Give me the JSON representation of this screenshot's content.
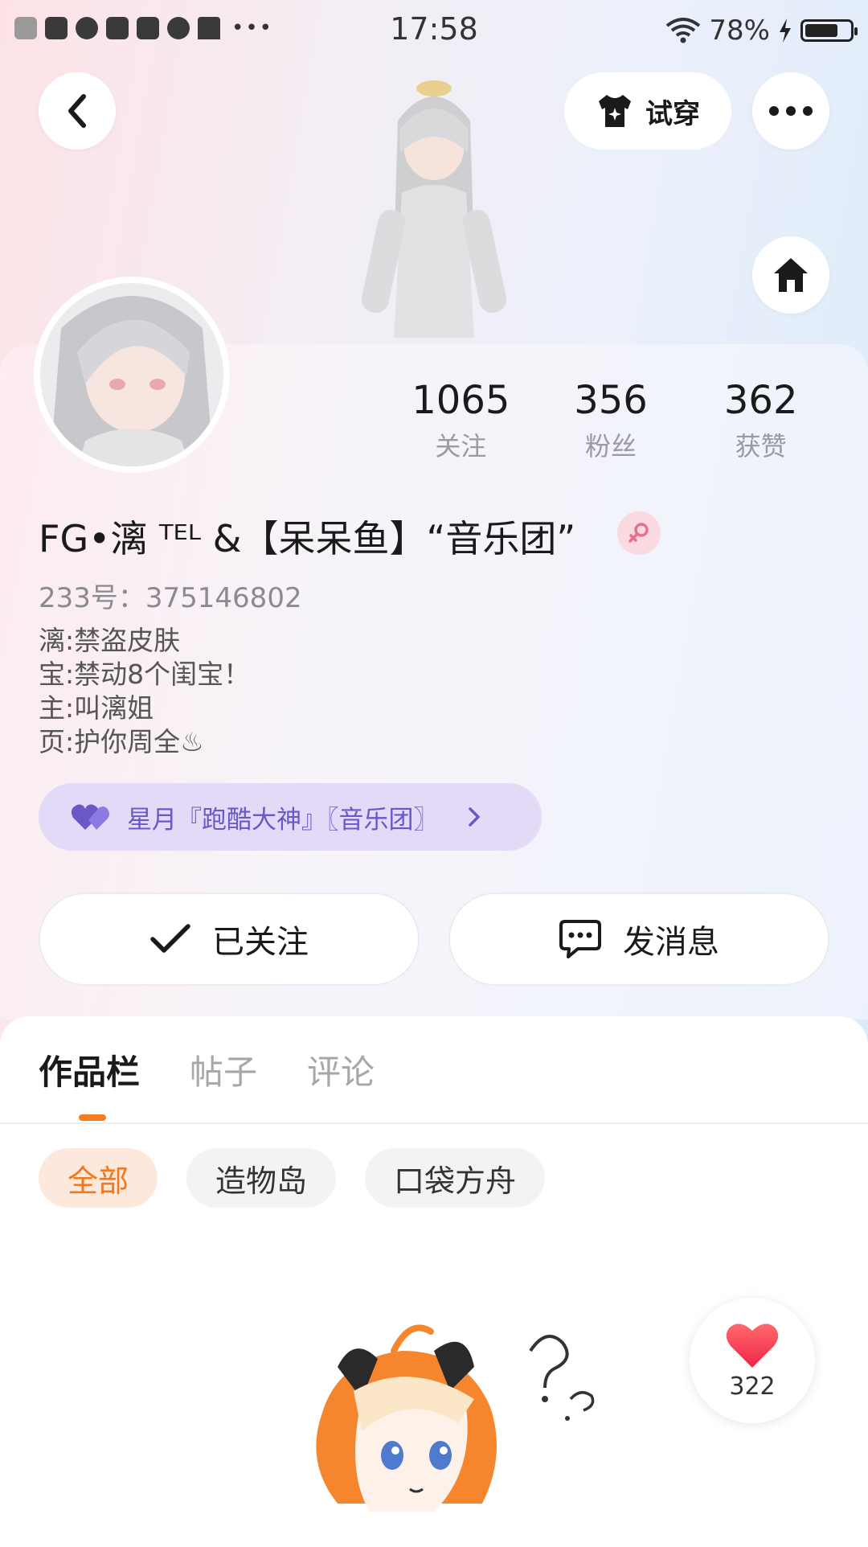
{
  "status_bar": {
    "time": "17:58",
    "battery": "78%",
    "battery_level": 0.78
  },
  "header": {
    "try_on_label": "试穿"
  },
  "stats": [
    {
      "value": "1065",
      "label": "关注"
    },
    {
      "value": "356",
      "label": "粉丝"
    },
    {
      "value": "362",
      "label": "获赞"
    }
  ],
  "profile": {
    "username": "FG•漓 ᵀᴱᴸ &【呆呆鱼】“音乐团”",
    "uid": "233号：375146802",
    "bio": [
      "漓:禁盗皮肤",
      "宝:禁动8个闺宝！",
      "主:叫漓姐",
      "页:护你周全♨"
    ],
    "group": "星月『跑酷大神』〖音乐团〗"
  },
  "actions": {
    "follow_label": "已关注",
    "message_label": "发消息"
  },
  "tabs": [
    "作品栏",
    "帖子",
    "评论"
  ],
  "filters": [
    "全部",
    "造物岛",
    "口袋方舟"
  ],
  "like": {
    "count": "322"
  },
  "colors": {
    "accent": "#f57c21",
    "group_text": "#6a58c8",
    "group_bg": "#e2daf6",
    "gender_badge": "#fbd9e1"
  }
}
